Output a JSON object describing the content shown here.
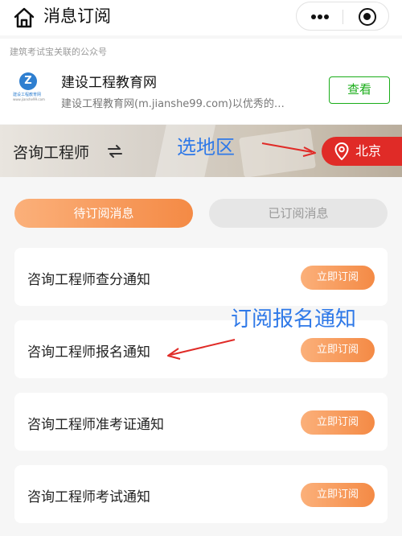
{
  "navbar": {
    "title": "消息订阅",
    "home_icon": "home-icon",
    "more_icon": "more-icon",
    "close_icon": "target-icon"
  },
  "official_account": {
    "caption": "建筑考试宝关联的公众号",
    "name": "建设工程教育网",
    "description": "建设工程教育网(m.jianshe99.com)以优秀的…",
    "view_label": "查看",
    "logo_letter": "Z",
    "logo_text": "建设工程教育网",
    "logo_sub": "www.jianshe99.com",
    "accent": "#1aad19"
  },
  "banner": {
    "exam_name": "咨询工程师",
    "swap_icon": "swap-icon",
    "annotation": "选地区",
    "region_label": "北京",
    "region_icon": "location-pin-icon",
    "region_color": "#e02b27"
  },
  "tabs": {
    "pending": "待订阅消息",
    "subscribed": "已订阅消息"
  },
  "notices": [
    {
      "title": "咨询工程师查分通知",
      "button": "立即订阅"
    },
    {
      "title": "咨询工程师报名通知",
      "button": "立即订阅"
    },
    {
      "title": "咨询工程师准考证通知",
      "button": "立即订阅"
    },
    {
      "title": "咨询工程师考试通知",
      "button": "立即订阅"
    }
  ],
  "annotations": {
    "registration": "订阅报名通知"
  },
  "colors": {
    "orange_start": "#fbb07a",
    "orange_end": "#f48a45",
    "annotation_blue": "#2f79e8",
    "arrow_red": "#e02b27"
  }
}
